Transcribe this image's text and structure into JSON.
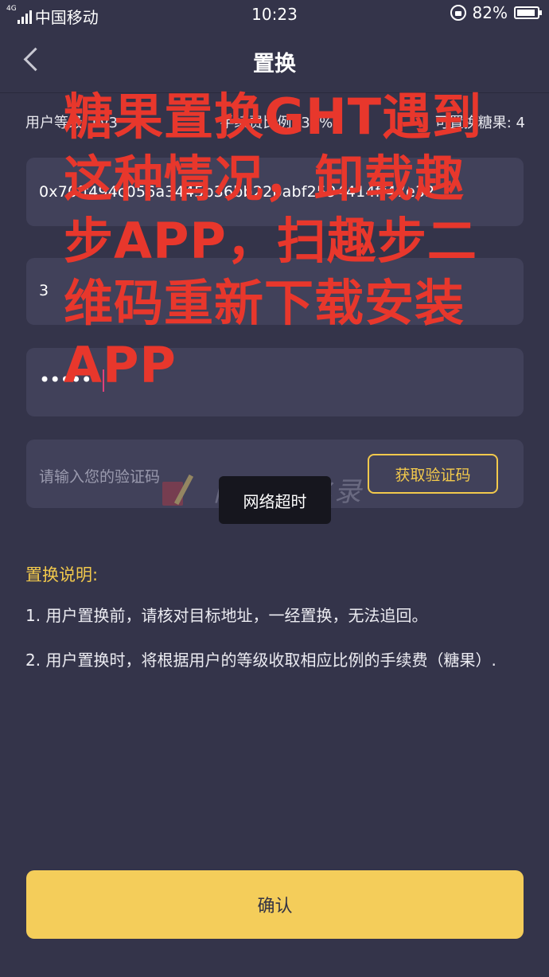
{
  "status_bar": {
    "network": "4G",
    "carrier": "中国移动",
    "time": "10:23",
    "battery": "82%"
  },
  "nav": {
    "title": "置换"
  },
  "info": {
    "level": "用户等级: Lv3",
    "fee_ratio": "手续费比例: 30%",
    "available": "可置换糖果: 4"
  },
  "form": {
    "address": "0x70ff494c056a3445b36bb22babf2594414ff47e32",
    "amount": "3",
    "password_mask": "••••••",
    "code_placeholder": "请输入您的验证码",
    "get_code_label": "获取验证码"
  },
  "toast": "网络超时",
  "watermark": "网络转化录",
  "description": {
    "title": "置换说明:",
    "item1": "1. 用户置换前，请核对目标地址，一经置换，无法追回。",
    "item2": "2. 用户置换时，将根据用户的等级收取相应比例的手续费（糖果）."
  },
  "confirm_label": "确认",
  "overlay_text": "糖果置换GHT遇到这种情况，卸载趣步APP，扫趣步二维码重新下载安装APP",
  "colors": {
    "background": "#34344a",
    "field": "#41415a",
    "accent": "#f2c94c",
    "overlay": "#e8372c"
  }
}
